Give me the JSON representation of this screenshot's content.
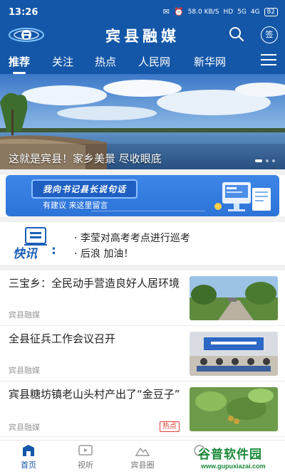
{
  "status_bar": {
    "time": "13:26",
    "speed": "58.0 KB/S",
    "net_type": "HD",
    "signal_1": "5G",
    "signal_2": "4G",
    "battery": "82"
  },
  "header": {
    "title": "宾县融媒",
    "sign_label": "签"
  },
  "tabs": [
    {
      "label": "推荐",
      "active": true
    },
    {
      "label": "关注",
      "active": false
    },
    {
      "label": "热点",
      "active": false
    },
    {
      "label": "人民网",
      "active": false
    },
    {
      "label": "新华网",
      "active": false
    }
  ],
  "banner": {
    "caption": "这就是宾县！家乡美景 尽收眼底"
  },
  "secretary_banner": {
    "title": "我向书记县长说句话",
    "subtitle": "有建议 来这里留言"
  },
  "news_flash": {
    "label": "快讯",
    "colon": ":",
    "items": [
      "· 李莹对高考考点进行巡考",
      "· 后浪 加油！"
    ]
  },
  "news": [
    {
      "title": "三宝乡：全民动手营造良好人居环境",
      "source": "宾县融媒",
      "tag": ""
    },
    {
      "title": "全县征兵工作会议召开",
      "source": "宾县融媒",
      "tag": ""
    },
    {
      "title": "宾县糖坊镇老山头村产出了“金豆子”",
      "source": "宾县融媒",
      "tag": "热点"
    }
  ],
  "bottom_nav": [
    {
      "label": "首页",
      "active": true
    },
    {
      "label": "视听",
      "active": false
    },
    {
      "label": "宾县圈",
      "active": false
    }
  ],
  "watermark": {
    "name": "谷普软件园",
    "url": "www.gupuxiazai.com"
  },
  "colors": {
    "brand": "#1457a8",
    "hot": "#e0403a"
  }
}
